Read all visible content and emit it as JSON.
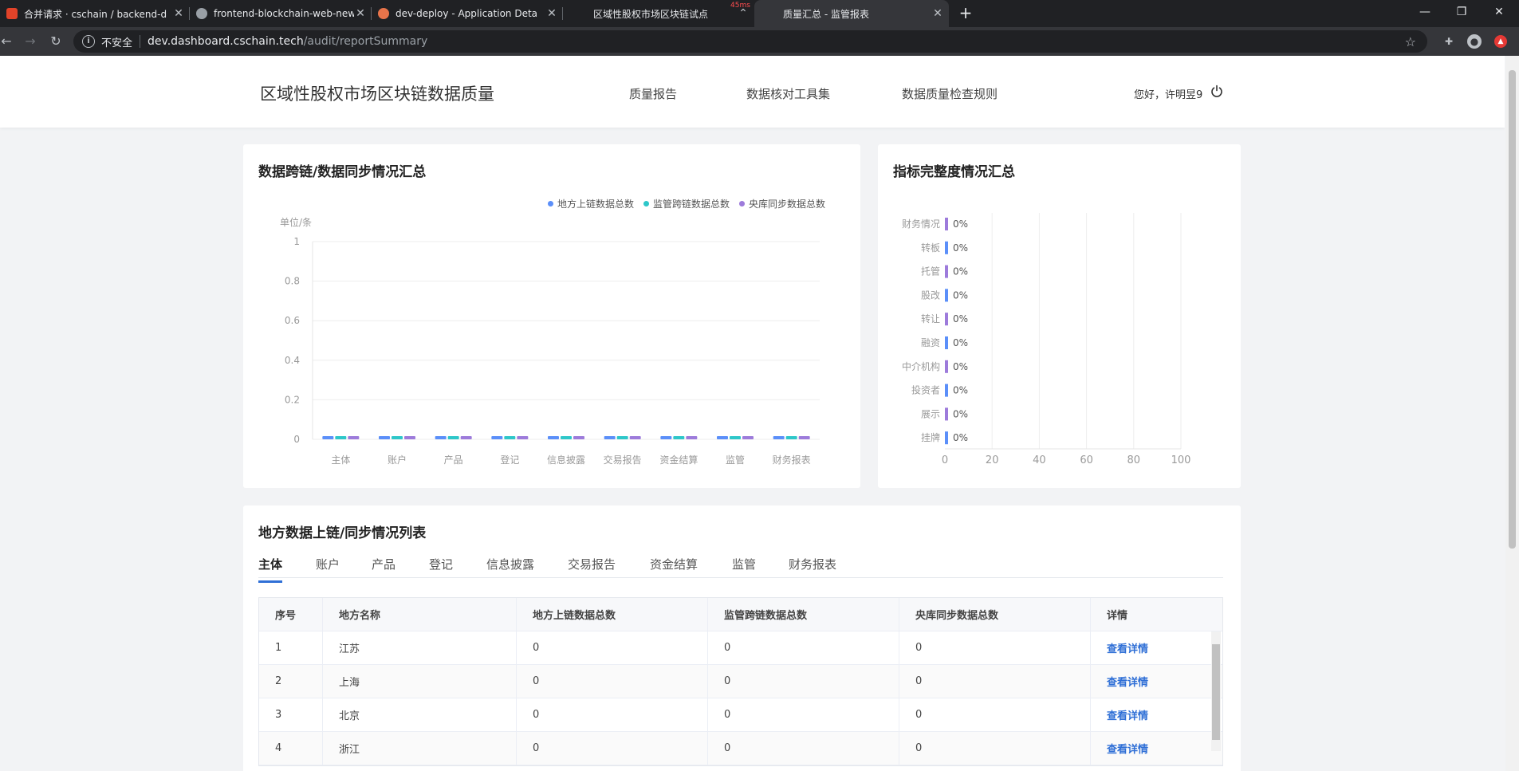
{
  "browser": {
    "tabs": [
      {
        "title": "合并请求 · cschain / backend-d",
        "icon_color": "#e24329",
        "icon": "gitlab-icon"
      },
      {
        "title": "frontend-blockchain-web-new",
        "icon_color": "#9aa0a6",
        "icon": "jenkins-icon"
      },
      {
        "title": "dev-deploy - Application Deta",
        "icon_color": "#e8744a",
        "icon": "argo-icon"
      },
      {
        "title": "区域性股权市场区块链试点",
        "icon_color": "#202124",
        "icon": ""
      },
      {
        "title": "质量汇总 - 监管报表",
        "icon_color": "#202124",
        "icon": ""
      }
    ],
    "ping": "45ms",
    "url_insecure": "不安全",
    "url_host": "dev.dashboard.cschain.tech",
    "url_path": "/audit/reportSummary"
  },
  "header": {
    "brand": "区域性股权市场区块链数据质量",
    "nav": [
      "质量报告",
      "数据核对工具集",
      "数据质量检查规则"
    ],
    "greeting": "您好，许明昱9"
  },
  "sync_chart": {
    "title": "数据跨链/数据同步情况汇总",
    "unit": "单位/条",
    "colors": [
      "#5b8ff9",
      "#2ec7c9",
      "#9d7bdb"
    ],
    "chart_data": {
      "type": "bar",
      "title": "",
      "xlabel": "",
      "ylabel": "单位/条",
      "categories": [
        "主体",
        "账户",
        "产品",
        "登记",
        "信息披露",
        "交易报告",
        "资金结算",
        "监管",
        "财务报表"
      ],
      "series": [
        {
          "name": "地方上链数据总数",
          "values": [
            0,
            0,
            0,
            0,
            0,
            0,
            0,
            0,
            0
          ]
        },
        {
          "name": "监管跨链数据总数",
          "values": [
            0,
            0,
            0,
            0,
            0,
            0,
            0,
            0,
            0
          ]
        },
        {
          "name": "央库同步数据总数",
          "values": [
            0,
            0,
            0,
            0,
            0,
            0,
            0,
            0,
            0
          ]
        }
      ],
      "ylim": [
        0,
        1
      ],
      "yticks": [
        "0",
        "0.2",
        "0.4",
        "0.6",
        "0.8",
        "1"
      ],
      "grid": true,
      "legend": "top-right"
    }
  },
  "completeness_chart": {
    "title": "指标完整度情况汇总",
    "colors": [
      "#9d7bdb",
      "#5b8ff9"
    ],
    "chart_data": {
      "type": "bar",
      "orientation": "horizontal",
      "categories": [
        "财务情况",
        "转板",
        "托管",
        "股改",
        "转让",
        "融资",
        "中介机构",
        "投资者",
        "展示",
        "挂牌"
      ],
      "values": [
        0,
        0,
        0,
        0,
        0,
        0,
        0,
        0,
        0,
        0
      ],
      "labels": [
        "0%",
        "0%",
        "0%",
        "0%",
        "0%",
        "0%",
        "0%",
        "0%",
        "0%",
        "0%"
      ],
      "xlim": [
        0,
        100
      ],
      "xticks": [
        "0",
        "20",
        "40",
        "60",
        "80",
        "100"
      ],
      "grid": true
    }
  },
  "table_section": {
    "title": "地方数据上链/同步情况列表",
    "tabs": [
      "主体",
      "账户",
      "产品",
      "登记",
      "信息披露",
      "交易报告",
      "资金结算",
      "监管",
      "财务报表"
    ],
    "active_tab": 0,
    "columns": [
      "序号",
      "地方名称",
      "地方上链数据总数",
      "监管跨链数据总数",
      "央库同步数据总数",
      "详情"
    ],
    "rows": [
      {
        "no": "1",
        "name": "江苏",
        "a": "0",
        "b": "0",
        "c": "0",
        "link": "查看详情"
      },
      {
        "no": "2",
        "name": "上海",
        "a": "0",
        "b": "0",
        "c": "0",
        "link": "查看详情"
      },
      {
        "no": "3",
        "name": "北京",
        "a": "0",
        "b": "0",
        "c": "0",
        "link": "查看详情"
      },
      {
        "no": "4",
        "name": "浙江",
        "a": "0",
        "b": "0",
        "c": "0",
        "link": "查看详情"
      }
    ]
  }
}
